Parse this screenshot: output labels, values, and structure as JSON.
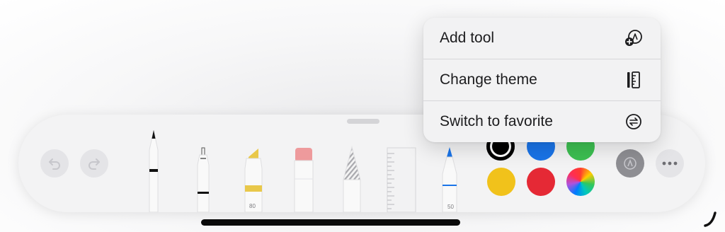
{
  "menu": {
    "items": [
      {
        "label": "Add tool",
        "icon": "add-shape-icon"
      },
      {
        "label": "Change theme",
        "icon": "theme-ruler-icon"
      },
      {
        "label": "Switch to favorite",
        "icon": "switch-arrows-icon"
      }
    ]
  },
  "toolbar": {
    "undo_icon": "undo-icon",
    "redo_icon": "redo-icon",
    "tools": [
      {
        "name": "pen",
        "label": ""
      },
      {
        "name": "fineliner",
        "label": ""
      },
      {
        "name": "highlighter",
        "label": "80"
      },
      {
        "name": "eraser",
        "label": ""
      },
      {
        "name": "pencil",
        "label": ""
      },
      {
        "name": "ruler",
        "label": ""
      },
      {
        "name": "crayon",
        "label": "50"
      }
    ],
    "colors": [
      "#000000",
      "#1a74e8",
      "#3cbf51",
      "#f1c21b",
      "#e52935",
      "color-wheel"
    ],
    "selected_color": "#000000",
    "more_icon": "more-ellipsis-icon"
  },
  "colors": {
    "accent_blue": "#1a74e8",
    "highlighter_yellow": "#e9c84a",
    "eraser_pink": "#ee9a9c"
  }
}
